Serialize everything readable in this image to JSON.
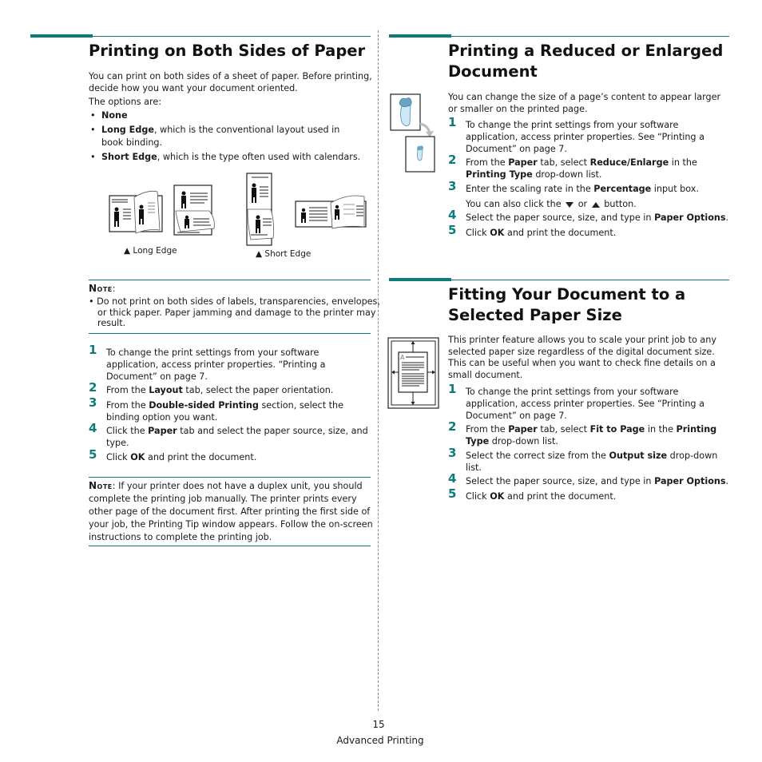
{
  "left": {
    "section1": {
      "title": "Printing on Both Sides of Paper",
      "intro": "You can print on both sides of a sheet of paper. Before printing, decide how you want your document oriented.",
      "options_label": "The options are:",
      "options": [
        {
          "bold": "None",
          "rest": ""
        },
        {
          "bold": "Long Edge",
          "rest": ", which is the conventional layout used in book binding."
        },
        {
          "bold": "Short Edge",
          "rest": ", which is the type often used with calendars."
        }
      ],
      "figure_captions": [
        "▲ Long Edge",
        "▲ Short Edge"
      ],
      "note1": {
        "label": "Note",
        "text": "• Do not print on both sides of labels, transparencies, envelopes, or thick paper. Paper jamming and damage to the printer may result."
      },
      "steps": [
        {
          "num": "1",
          "parts": [
            [
              "",
              "To change the print settings from your software application, access printer properties. “Printing a Document” on page 7."
            ]
          ]
        },
        {
          "num": "2",
          "parts": [
            [
              "",
              "From the "
            ],
            [
              "b",
              "Layout"
            ],
            [
              "",
              " tab, select the paper orientation."
            ]
          ]
        },
        {
          "num": "3",
          "parts": [
            [
              "",
              "From the "
            ],
            [
              "b",
              "Double-sided Printing"
            ],
            [
              "",
              " section, select the binding option you want."
            ]
          ]
        },
        {
          "num": "4",
          "parts": [
            [
              "",
              "Click the "
            ],
            [
              "b",
              "Paper"
            ],
            [
              "",
              " tab and select the paper source, size, and type."
            ]
          ]
        },
        {
          "num": "5",
          "parts": [
            [
              "",
              "Click "
            ],
            [
              "b",
              "OK"
            ],
            [
              "",
              " and print the document."
            ]
          ]
        }
      ],
      "note2": {
        "label": "Note",
        "text": ": If your printer does not have a duplex unit, you should complete the printing job manually. The printer prints every other page of the document first. After printing the first side of your job, the Printing Tip window appears. Follow the on-screen instructions to complete the printing job."
      }
    }
  },
  "right": {
    "section2": {
      "title": "Printing a Reduced or Enlarged Document",
      "intro": "You can change the size of a page’s content to appear larger or smaller on the printed page.",
      "steps": [
        {
          "num": "1",
          "parts": [
            [
              "",
              "To change the print settings from your software application, access printer properties. See “Printing a Document” on page 7."
            ]
          ]
        },
        {
          "num": "2",
          "parts": [
            [
              "",
              "From the "
            ],
            [
              "b",
              "Paper"
            ],
            [
              "",
              " tab, select "
            ],
            [
              "b",
              "Reduce/Enlarge"
            ],
            [
              "",
              " in the "
            ],
            [
              "b",
              "Printing Type"
            ],
            [
              "",
              " drop-down list."
            ]
          ]
        },
        {
          "num": "3",
          "parts": [
            [
              "",
              "Enter the scaling rate in the "
            ],
            [
              "b",
              "Percentage"
            ],
            [
              "",
              " input box."
            ]
          ]
        },
        {
          "num": "4",
          "parts": [
            [
              "",
              "Select the paper source, size, and type in "
            ],
            [
              "b",
              "Paper Options"
            ],
            [
              "",
              "."
            ]
          ]
        },
        {
          "num": "5",
          "parts": [
            [
              "",
              "Click "
            ],
            [
              "b",
              "OK"
            ],
            [
              "",
              " and print the document."
            ]
          ]
        }
      ],
      "step3_extra": {
        "before": "You can also click the ",
        "mid": " or ",
        "after": " button."
      }
    },
    "section3": {
      "title": "Fitting Your Document to a Selected Paper Size",
      "intro": "This printer feature allows you to scale your print job to any selected paper size regardless of the digital document size. This can be useful when you want to check fine details on a small document.",
      "steps": [
        {
          "num": "1",
          "parts": [
            [
              "",
              "To change the print settings from your software application, access printer properties. See “Printing a Document” on page 7."
            ]
          ]
        },
        {
          "num": "2",
          "parts": [
            [
              "",
              "From the "
            ],
            [
              "b",
              "Paper"
            ],
            [
              "",
              " tab, select "
            ],
            [
              "b",
              "Fit to Page"
            ],
            [
              "",
              " in the "
            ],
            [
              "b",
              "Printing Type"
            ],
            [
              "",
              " drop-down list."
            ]
          ]
        },
        {
          "num": "3",
          "parts": [
            [
              "",
              "Select the correct size from the "
            ],
            [
              "b",
              "Output size"
            ],
            [
              "",
              " drop-down list."
            ]
          ]
        },
        {
          "num": "4",
          "parts": [
            [
              "",
              "Select the paper source, size, and type in "
            ],
            [
              "b",
              "Paper Options"
            ],
            [
              "",
              "."
            ]
          ]
        },
        {
          "num": "5",
          "parts": [
            [
              "",
              "Click "
            ],
            [
              "b",
              "OK"
            ],
            [
              "",
              " and print the document."
            ]
          ]
        }
      ],
      "figure_letter": "A"
    }
  },
  "footer": {
    "page_number": "15",
    "chapter": "Advanced Printing"
  },
  "colors": {
    "accent": "#0e7b78",
    "text": "#1a1a1a"
  }
}
